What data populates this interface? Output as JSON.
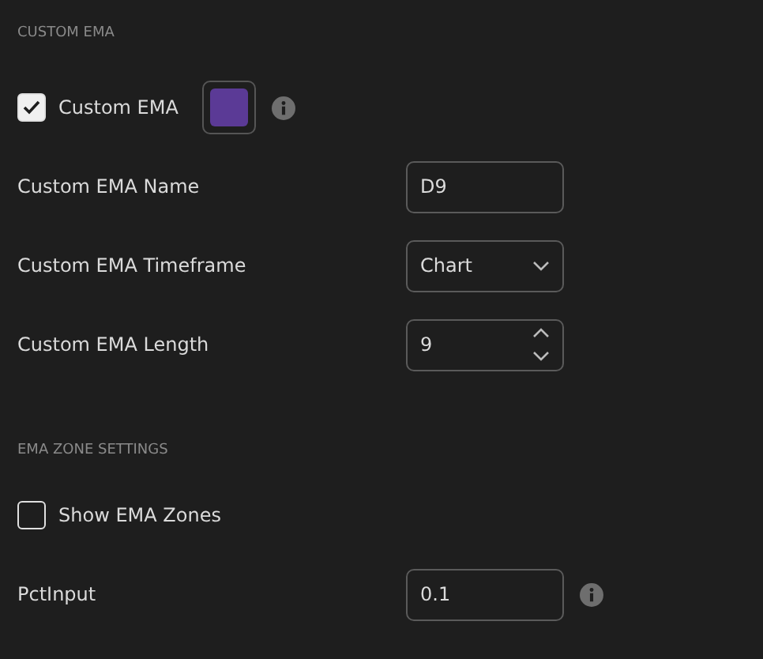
{
  "sections": [
    {
      "title": "CUSTOM EMA",
      "rows": [
        {
          "kind": "checkbox",
          "label": "Custom EMA",
          "checked": true,
          "color": "#5b3a96",
          "info": true
        },
        {
          "kind": "text",
          "label": "Custom EMA Name",
          "value": "D9"
        },
        {
          "kind": "select",
          "label": "Custom EMA Timeframe",
          "value": "Chart"
        },
        {
          "kind": "number",
          "label": "Custom EMA Length",
          "value": "9"
        }
      ]
    },
    {
      "title": "EMA ZONE SETTINGS",
      "rows": [
        {
          "kind": "checkbox",
          "label": "Show EMA Zones",
          "checked": false
        },
        {
          "kind": "text",
          "label": "PctInput",
          "value": "0.1",
          "info": true
        }
      ]
    }
  ]
}
